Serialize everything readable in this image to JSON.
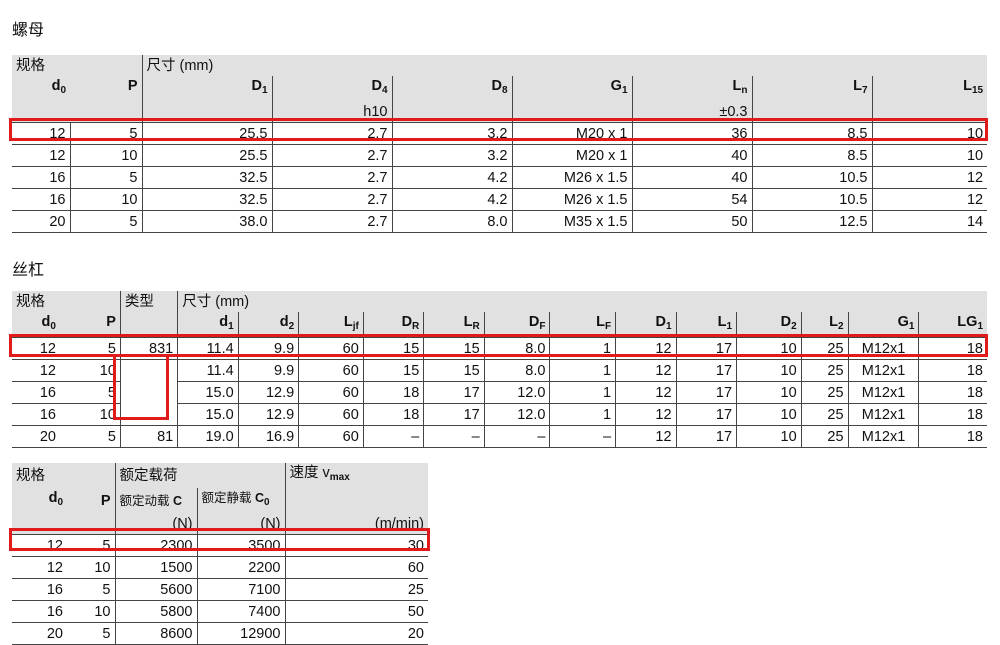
{
  "nut": {
    "title": "螺母",
    "group_spec": "规格",
    "group_dim": "尺寸 (mm)",
    "cols": [
      {
        "sym": "d",
        "sub": "0",
        "unit": ""
      },
      {
        "sym": "P",
        "sub": "",
        "unit": ""
      },
      {
        "sym": "D",
        "sub": "1",
        "unit": ""
      },
      {
        "sym": "D",
        "sub": "4",
        "unit": "h10"
      },
      {
        "sym": "D",
        "sub": "8",
        "unit": ""
      },
      {
        "sym": "G",
        "sub": "1",
        "unit": ""
      },
      {
        "sym": "L",
        "sub": "n",
        "unit": "±0.3"
      },
      {
        "sym": "L",
        "sub": "7",
        "unit": ""
      },
      {
        "sym": "L",
        "sub": "15",
        "unit": ""
      }
    ],
    "rows": [
      [
        "12",
        "5",
        "25.5",
        "2.7",
        "3.2",
        "M20 x 1",
        "36",
        "8.5",
        "10"
      ],
      [
        "12",
        "10",
        "25.5",
        "2.7",
        "3.2",
        "M20 x 1",
        "40",
        "8.5",
        "10"
      ],
      [
        "16",
        "5",
        "32.5",
        "2.7",
        "4.2",
        "M26 x 1.5",
        "40",
        "10.5",
        "12"
      ],
      [
        "16",
        "10",
        "32.5",
        "2.7",
        "4.2",
        "M26 x 1.5",
        "54",
        "10.5",
        "12"
      ],
      [
        "20",
        "5",
        "38.0",
        "2.7",
        "8.0",
        "M35 x 1.5",
        "50",
        "12.5",
        "14"
      ]
    ]
  },
  "screw": {
    "title": "丝杠",
    "group_spec": "规格",
    "group_type": "类型",
    "group_dim": "尺寸 (mm)",
    "cols": [
      {
        "sym": "d",
        "sub": "0"
      },
      {
        "sym": "P",
        "sub": ""
      },
      {
        "sym": "",
        "sub": ""
      },
      {
        "sym": "d",
        "sub": "1"
      },
      {
        "sym": "d",
        "sub": "2"
      },
      {
        "sym": "L",
        "sub": "jf"
      },
      {
        "sym": "D",
        "sub": "R"
      },
      {
        "sym": "L",
        "sub": "R"
      },
      {
        "sym": "D",
        "sub": "F"
      },
      {
        "sym": "L",
        "sub": "F"
      },
      {
        "sym": "D",
        "sub": "1"
      },
      {
        "sym": "L",
        "sub": "1"
      },
      {
        "sym": "D",
        "sub": "2"
      },
      {
        "sym": "L",
        "sub": "2"
      },
      {
        "sym": "G",
        "sub": "1"
      },
      {
        "sym": "LG",
        "sub": "1"
      }
    ],
    "rows": [
      [
        "12",
        "5",
        "831",
        "11.4",
        "9.9",
        "60",
        "15",
        "15",
        "8.0",
        "1",
        "12",
        "17",
        "10",
        "25",
        "M12x1",
        "18"
      ],
      [
        "12",
        "10",
        "",
        "11.4",
        "9.9",
        "60",
        "15",
        "15",
        "8.0",
        "1",
        "12",
        "17",
        "10",
        "25",
        "M12x1",
        "18"
      ],
      [
        "16",
        "5",
        "",
        "15.0",
        "12.9",
        "60",
        "18",
        "17",
        "12.0",
        "1",
        "12",
        "17",
        "10",
        "25",
        "M12x1",
        "18"
      ],
      [
        "16",
        "10",
        "",
        "15.0",
        "12.9",
        "60",
        "18",
        "17",
        "12.0",
        "1",
        "12",
        "17",
        "10",
        "25",
        "M12x1",
        "18"
      ],
      [
        "20",
        "5",
        "81",
        "19.0",
        "16.9",
        "60",
        "–",
        "–",
        "–",
        "–",
        "12",
        "17",
        "10",
        "25",
        "M12x1",
        "18"
      ]
    ]
  },
  "load": {
    "group_spec": "规格",
    "group_load": "额定载荷",
    "group_speed": "速度 v",
    "speed_sub": "max",
    "d0": "d",
    "d0_sub": "0",
    "p": "P",
    "dyn_label": "额定动载 ",
    "dyn_sym": "C",
    "stat_label": "额定静载 ",
    "stat_sym": "C",
    "stat_sub": "0",
    "unit_n": "(N)",
    "unit_speed": "(m/min)",
    "rows": [
      [
        "12",
        "5",
        "2300",
        "3500",
        "30"
      ],
      [
        "12",
        "10",
        "1500",
        "2200",
        "60"
      ],
      [
        "16",
        "5",
        "5600",
        "7100",
        "25"
      ],
      [
        "16",
        "10",
        "5800",
        "7400",
        "50"
      ],
      [
        "20",
        "5",
        "8600",
        "12900",
        "20"
      ]
    ]
  },
  "colors": {
    "highlight": "#e01b1b",
    "header_bg": "#e1e1e1"
  }
}
